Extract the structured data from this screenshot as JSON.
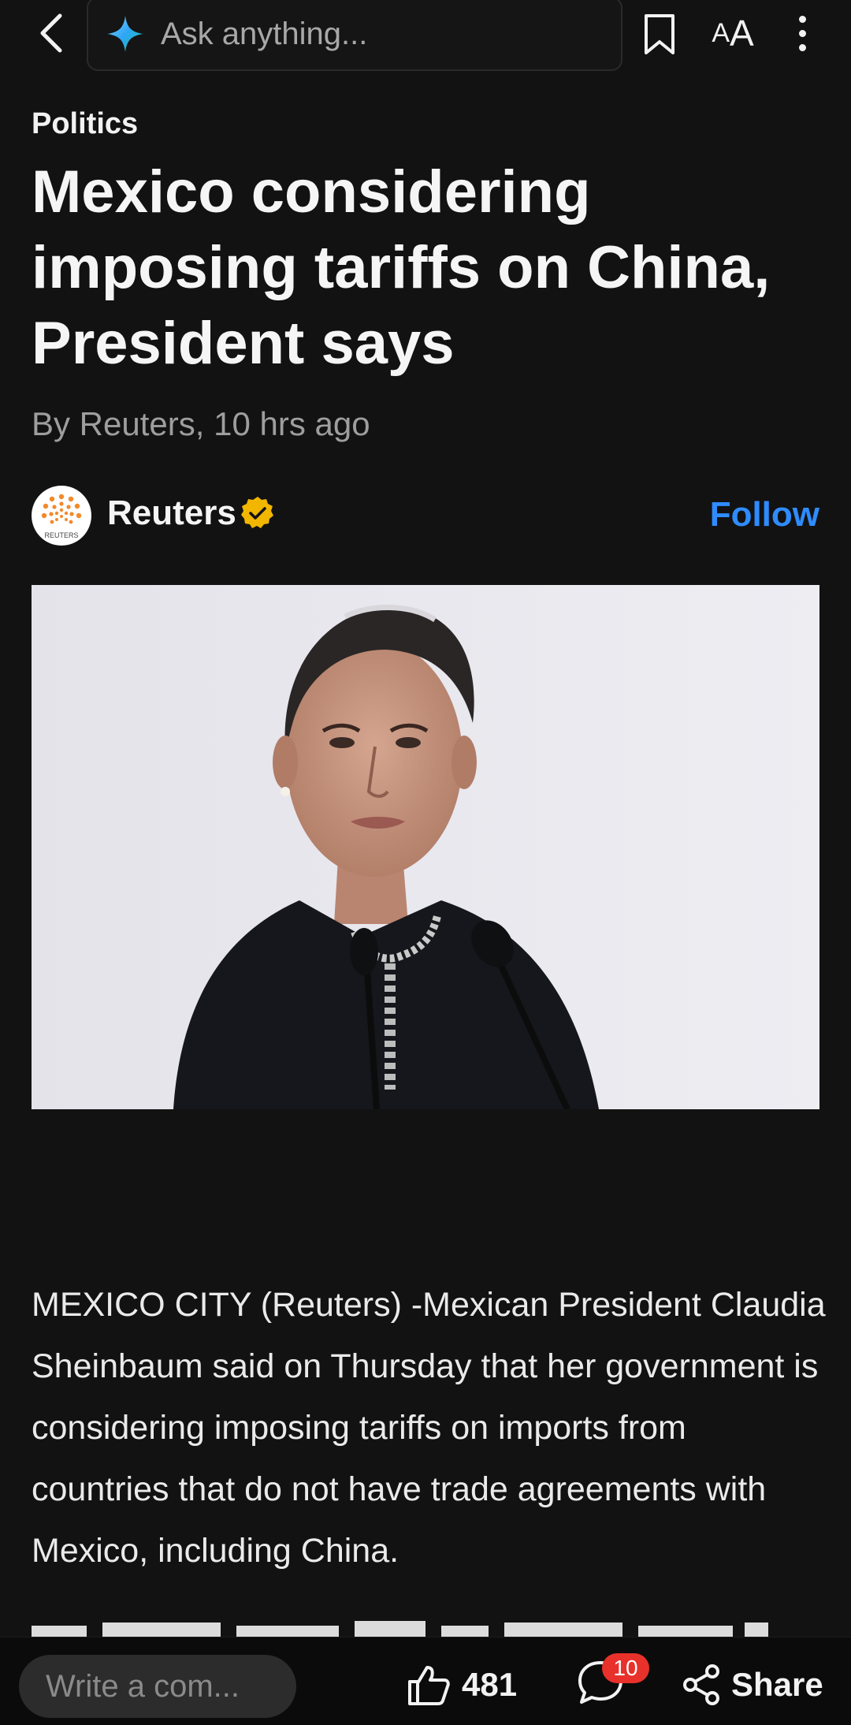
{
  "topbar": {
    "ask_placeholder": "Ask anything...",
    "back_icon": "chevron-left-icon",
    "ai_icon": "sparkle-icon",
    "bookmark_icon": "bookmark-icon",
    "text_size_small": "A",
    "text_size_big": "A",
    "more_icon": "more-vertical-icon"
  },
  "article": {
    "category": "Politics",
    "headline": "Mexico considering imposing tariffs on China, President says",
    "byline": "By Reuters,  10 hrs ago",
    "source": {
      "name": "Reuters",
      "logo_text": "REUTERS",
      "follow_label": "Follow",
      "verified": true
    },
    "body": "MEXICO CITY (Reuters) -Mexican President Claudia Sheinbaum said on Thursday that her government is considering imposing tariffs on imports from countries that do not have trade agreements with Mexico, including China."
  },
  "bottombar": {
    "comment_placeholder": "Write a com...",
    "like_count": "481",
    "comment_count": "10",
    "share_label": "Share"
  },
  "colors": {
    "background": "#121212",
    "accent": "#2f8cff",
    "badge": "#e8312a",
    "verified": "#f2b600"
  }
}
